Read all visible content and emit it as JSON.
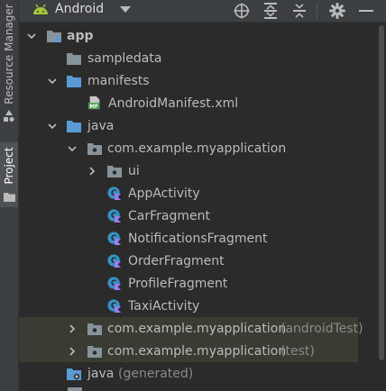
{
  "sidebar": {
    "resource_manager": "Resource Manager",
    "project": "Project"
  },
  "toolbar": {
    "view_mode": "Android",
    "icons": [
      "android-icon",
      "dropdown-arrow-icon",
      "locate-icon",
      "expand-all-icon",
      "collapse-all-icon",
      "gear-icon",
      "minimize-icon"
    ]
  },
  "tree": {
    "app": "app",
    "sampledata": "sampledata",
    "manifests": "manifests",
    "manifest_file": "AndroidManifest.xml",
    "java": "java",
    "package_main": "com.example.myapplication",
    "ui": "ui",
    "classes": [
      "AppActivity",
      "CarFragment",
      "NotificationsFragment",
      "OrderFragment",
      "ProfileFragment",
      "TaxiActivity"
    ],
    "package_android_test": "com.example.myapplication",
    "android_test_tag": "(androidTest)",
    "package_test": "com.example.myapplication",
    "test_tag": "(test)",
    "java_generated": "java",
    "generated_tag": "(generated)"
  },
  "colors": {
    "background": "#2b2b2b",
    "toolbar": "#3c3f41",
    "folder": "#87939a",
    "blue_folder": "#5a9bd5",
    "class_icon": "#3592c4",
    "class_badge": "#9c7cf4",
    "android_green": "#a4c639",
    "vcs_highlight": "#3a3b33"
  }
}
